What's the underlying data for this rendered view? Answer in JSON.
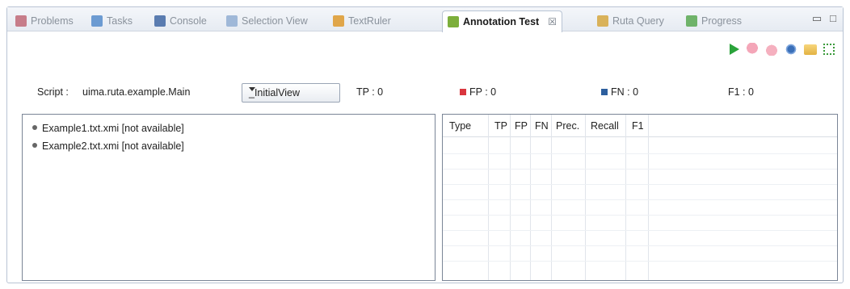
{
  "tabs": [
    {
      "label": "Problems",
      "icon": "problems-icon",
      "color": "#c77d8a"
    },
    {
      "label": "Tasks",
      "icon": "tasks-icon",
      "color": "#6c9bd2"
    },
    {
      "label": "Console",
      "icon": "console-icon",
      "color": "#5a7cb0"
    },
    {
      "label": "Selection View",
      "icon": "selection-view-icon",
      "color": "#9fb8d8"
    },
    {
      "label": "TextRuler",
      "icon": "pencil-icon",
      "color": "#e0a64a"
    },
    {
      "label": "Annotation Test",
      "icon": "annotation-test-icon",
      "color": "#7cae3b",
      "active": true,
      "close": "☒"
    },
    {
      "label": "Ruta Query",
      "icon": "ruta-query-icon",
      "color": "#d9b25a"
    },
    {
      "label": "Progress",
      "icon": "progress-icon",
      "color": "#6fb36a"
    }
  ],
  "window_controls": {
    "minimize": "▭",
    "maximize": "□"
  },
  "toolbar": [
    "run-icon",
    "thumbs-down-icon",
    "thumbs-up-icon",
    "gear-icon",
    "folder-icon",
    "expand-icon"
  ],
  "info": {
    "script_label": "Script :",
    "script_value": "uima.ruta.example.Main",
    "view_select": "_InitialView",
    "tp": "TP :  0",
    "fp": "FP :  0",
    "fn": "FN :  0",
    "f1": "F1 :  0",
    "fp_color": "#d9363e",
    "fn_color": "#2d5f9e"
  },
  "files": [
    "Example1.txt.xmi [not available]",
    "Example2.txt.xmi [not available]"
  ],
  "table": {
    "columns": [
      "Type",
      "TP",
      "FP",
      "FN",
      "Prec.",
      "Recall",
      "F1"
    ]
  }
}
